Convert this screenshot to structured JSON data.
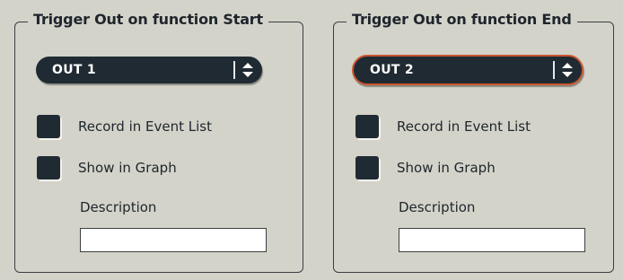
{
  "start": {
    "title": "Trigger Out on function Start",
    "output": {
      "value": "OUT 1"
    },
    "record_label": "Record in Event List",
    "graph_label": "Show in Graph",
    "description_label": "Description",
    "description_value": ""
  },
  "end": {
    "title": "Trigger Out on function End",
    "output": {
      "value": "OUT 2"
    },
    "record_label": "Record in Event List",
    "graph_label": "Show in Graph",
    "description_label": "Description",
    "description_value": ""
  },
  "colors": {
    "background": "#d3d3ca",
    "control_dark": "#1f2a33",
    "focus_outline": "#c9572e"
  },
  "icons": {
    "dropdown": "up-down-arrows-icon"
  }
}
